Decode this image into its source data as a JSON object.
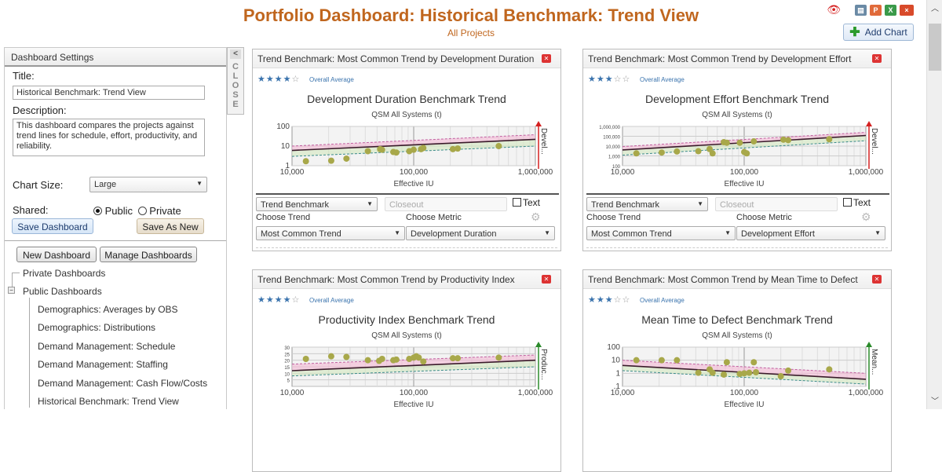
{
  "header": {
    "title": "Portfolio Dashboard: Historical Benchmark: Trend View",
    "subtitle": "All Projects",
    "icons": [
      "hide-eye-icon",
      "print-icon",
      "powerpoint-icon",
      "excel-icon",
      "close-icon"
    ],
    "add_chart_label": "Add Chart"
  },
  "sidebar": {
    "header": "Dashboard Settings",
    "title_label": "Title:",
    "title_value": "Historical Benchmark:  Trend View",
    "description_label": "Description:",
    "description_value": "This dashboard compares the projects against trend lines for schedule, effort, productivity, and reliability.",
    "chart_size_label": "Chart Size:",
    "chart_size_value": "Large",
    "shared_label": "Shared:",
    "shared_options": [
      "Public",
      "Private"
    ],
    "shared_selected": "Public",
    "save_dashboard_label": "Save Dashboard",
    "save_as_new_label": "Save As New",
    "new_dashboard_label": "New Dashboard",
    "manage_dashboards_label": "Manage Dashboards",
    "close_tab_label": "CLOSE",
    "tree": {
      "private": "Private Dashboards",
      "public": "Public Dashboards",
      "public_items": [
        "Demographics: Averages by OBS",
        "Demographics: Distributions",
        "Demand Management: Schedule",
        "Demand Management: Staffing",
        "Demand Management: Cash Flow/Costs",
        "Historical Benchmark: Trend View"
      ]
    }
  },
  "panels": [
    {
      "header": "Trend Benchmark: Most Common Trend by Development Duration",
      "rating": 4,
      "rating_max": 5,
      "rating_label": "Overall Average",
      "chart_title": "Development Duration Benchmark Trend",
      "chart_subtitle": "QSM All Systems (t)",
      "type_select": "Trend Benchmark",
      "phase_select": "Closeout",
      "text_label": "Text",
      "choose_trend_label": "Choose Trend",
      "trend_value": "Most Common Trend",
      "choose_metric_label": "Choose Metric",
      "metric_value": "Development Duration"
    },
    {
      "header": "Trend Benchmark: Most Common Trend by Development Effort",
      "rating": 3,
      "rating_max": 5,
      "rating_label": "Overall Average",
      "chart_title": "Development Effort Benchmark Trend",
      "chart_subtitle": "QSM All Systems (t)",
      "type_select": "Trend Benchmark",
      "phase_select": "Closeout",
      "text_label": "Text",
      "choose_trend_label": "Choose Trend",
      "trend_value": "Most Common Trend",
      "choose_metric_label": "Choose Metric",
      "metric_value": "Development Effort"
    },
    {
      "header": "Trend Benchmark: Most Common Trend by Productivity Index",
      "rating": 4,
      "rating_max": 5,
      "rating_label": "Overall Average",
      "chart_title": "Productivity Index Benchmark Trend",
      "chart_subtitle": "QSM All Systems (t)"
    },
    {
      "header": "Trend Benchmark: Most Common Trend by Mean Time to Defect",
      "rating": 3,
      "rating_max": 5,
      "rating_label": "Overall Average",
      "chart_title": "Mean Time to Defect Benchmark Trend",
      "chart_subtitle": "QSM All Systems (t)"
    }
  ],
  "chart_data": [
    {
      "type": "scatter",
      "title": "Development Duration Benchmark Trend",
      "subtitle": "QSM All Systems (t)",
      "xlabel": "Effective IU",
      "xscale": "log",
      "xlim": [
        10000,
        1000000
      ],
      "xticks": [
        "10,000",
        "100,000",
        "1,000,000"
      ],
      "yscale": "log",
      "ylim": [
        1,
        100
      ],
      "yticks": [
        "1",
        "10",
        "100"
      ],
      "marker_label": "Devel...",
      "marker_color": "#d42020",
      "trend": {
        "avg": [
          6,
          22
        ],
        "upper": [
          10,
          38
        ],
        "lower": [
          3,
          10
        ]
      },
      "points": [
        [
          13000,
          1.7
        ],
        [
          21000,
          1.8
        ],
        [
          28000,
          2.3
        ],
        [
          42000,
          5.5
        ],
        [
          53000,
          7
        ],
        [
          55000,
          6.5
        ],
        [
          68000,
          5
        ],
        [
          72000,
          4.7
        ],
        [
          92000,
          5.5
        ],
        [
          100000,
          6.5
        ],
        [
          115000,
          7
        ],
        [
          120000,
          8
        ],
        [
          210000,
          7
        ],
        [
          230000,
          7.5
        ],
        [
          500000,
          10
        ]
      ]
    },
    {
      "type": "scatter",
      "title": "Development Effort Benchmark Trend",
      "subtitle": "QSM All Systems (t)",
      "xlabel": "Effective IU",
      "xscale": "log",
      "xlim": [
        10000,
        1000000
      ],
      "xticks": [
        "10,000",
        "100,000",
        "1,000,000"
      ],
      "yscale": "log",
      "ylim": [
        100,
        1000000
      ],
      "yticks": [
        "100",
        "1,000",
        "10,000",
        "100,000",
        "1,000,000"
      ],
      "marker_label": "Devel...",
      "marker_color": "#d42020",
      "trend": {
        "avg": [
          4000,
          120000
        ],
        "upper": [
          9000,
          250000
        ],
        "lower": [
          1200,
          35000
        ]
      },
      "points": [
        [
          13000,
          1800
        ],
        [
          21000,
          2200
        ],
        [
          28000,
          2800
        ],
        [
          42000,
          3000
        ],
        [
          52000,
          5000
        ],
        [
          55000,
          1800
        ],
        [
          68000,
          25000
        ],
        [
          72000,
          22000
        ],
        [
          92000,
          22000
        ],
        [
          100000,
          2500
        ],
        [
          105000,
          1800
        ],
        [
          120000,
          30000
        ],
        [
          210000,
          45000
        ],
        [
          230000,
          40000
        ],
        [
          500000,
          50000
        ]
      ]
    },
    {
      "type": "scatter",
      "title": "Productivity Index Benchmark Trend",
      "subtitle": "QSM All Systems (t)",
      "xlabel": "Effective IU",
      "xscale": "log",
      "xlim": [
        10000,
        1000000
      ],
      "xticks": [
        "10,000",
        "100,000",
        "1,000,000"
      ],
      "yscale": "linear",
      "ylim": [
        0,
        30
      ],
      "yticks": [
        "5",
        "10",
        "15",
        "20",
        "25",
        "30"
      ],
      "marker_label": "Produc...",
      "marker_color": "#2a8a2a",
      "trend": {
        "avg": [
          12,
          20
        ],
        "upper": [
          17,
          24
        ],
        "lower": [
          8,
          15
        ]
      },
      "points": [
        [
          13000,
          21
        ],
        [
          21000,
          23
        ],
        [
          28000,
          22.5
        ],
        [
          42000,
          20
        ],
        [
          52000,
          19.5
        ],
        [
          55000,
          21
        ],
        [
          68000,
          20
        ],
        [
          72000,
          20.5
        ],
        [
          92000,
          21
        ],
        [
          100000,
          22
        ],
        [
          105000,
          23
        ],
        [
          110000,
          22
        ],
        [
          120000,
          19
        ],
        [
          210000,
          21.5
        ],
        [
          230000,
          21.5
        ],
        [
          500000,
          22
        ]
      ]
    },
    {
      "type": "scatter",
      "title": "Mean Time to Defect Benchmark Trend",
      "subtitle": "QSM All Systems (t)",
      "xlabel": "Effective IU",
      "xscale": "log",
      "xlim": [
        10000,
        1000000
      ],
      "xticks": [
        "10,000",
        "100,000",
        "1,000,000"
      ],
      "yscale": "log",
      "ylim": [
        0.1,
        100
      ],
      "yticks": [
        ".1",
        "1",
        "10",
        "100"
      ],
      "marker_label": "Mean...",
      "marker_color": "#2a8a2a",
      "trend": {
        "avg": [
          4,
          0.35
        ],
        "upper": [
          10,
          1
        ],
        "lower": [
          1.6,
          0.15
        ]
      },
      "points": [
        [
          13000,
          10
        ],
        [
          21000,
          10
        ],
        [
          28000,
          10
        ],
        [
          42000,
          1.1
        ],
        [
          52000,
          2
        ],
        [
          55000,
          1.1
        ],
        [
          68000,
          0.8
        ],
        [
          72000,
          7
        ],
        [
          92000,
          0.9
        ],
        [
          100000,
          1
        ],
        [
          110000,
          1.1
        ],
        [
          120000,
          7
        ],
        [
          125000,
          1.2
        ],
        [
          200000,
          0.6
        ],
        [
          230000,
          1.6
        ],
        [
          500000,
          2
        ]
      ]
    }
  ]
}
